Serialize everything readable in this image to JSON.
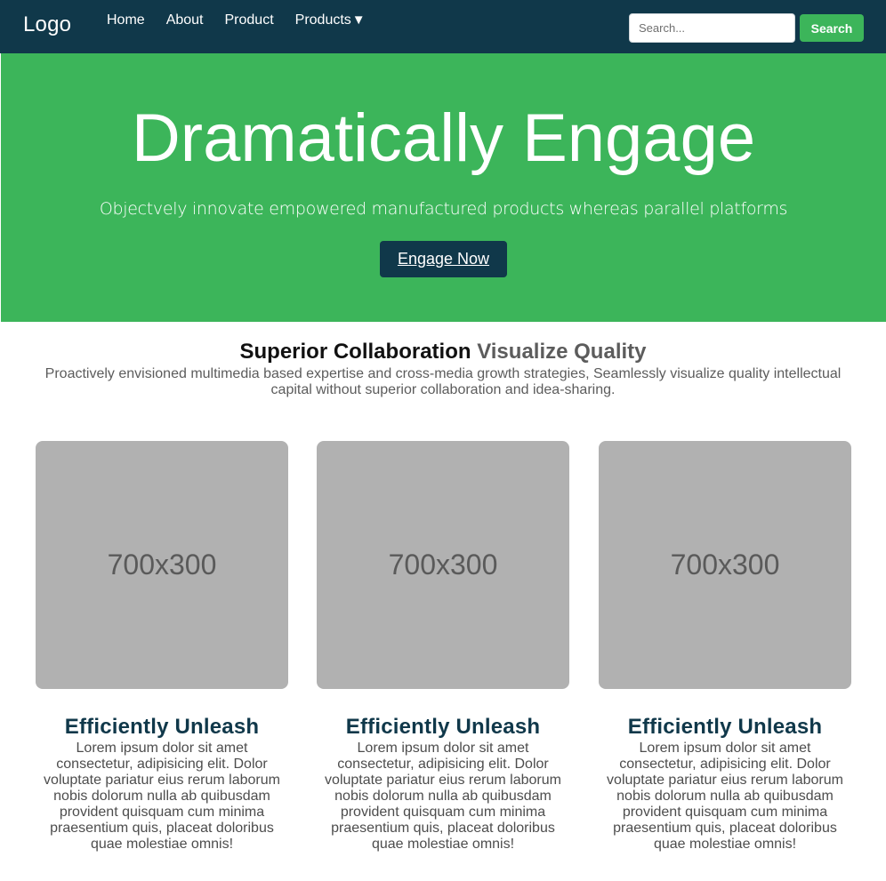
{
  "nav": {
    "logo": "Logo",
    "links": [
      {
        "label": "Home"
      },
      {
        "label": "About"
      },
      {
        "label": "Product"
      },
      {
        "label": "Products",
        "caret": "▼"
      }
    ],
    "search": {
      "placeholder": "Search...",
      "button_label": "Search"
    }
  },
  "hero": {
    "title": "Dramatically Engage",
    "subtitle": "Objectvely innovate empowered manufactured products whereas parallel platforms",
    "cta_label": "Engage Now"
  },
  "section": {
    "title_part1": "Superior Collaboration",
    "title_part2": "Visualize Quality",
    "description": "Proactively envisioned multimedia based expertise and cross-media growth strategies, Seamlessly visualize quality intellectual capital without superior collaboration and idea-sharing."
  },
  "cards": [
    {
      "image_label": "700x300",
      "title": "Efficiently Unleash",
      "text": "Lorem ipsum dolor sit amet consectetur, adipisicing elit. Dolor voluptate pariatur eius rerum laborum nobis dolorum nulla ab quibusdam provident quisquam cum minima praesentium quis, placeat doloribus quae molestiae omnis!"
    },
    {
      "image_label": "700x300",
      "title": "Efficiently Unleash",
      "text": "Lorem ipsum dolor sit amet consectetur, adipisicing elit. Dolor voluptate pariatur eius rerum laborum nobis dolorum nulla ab quibusdam provident quisquam cum minima praesentium quis, placeat doloribus quae molestiae omnis!"
    },
    {
      "image_label": "700x300",
      "title": "Efficiently Unleash",
      "text": "Lorem ipsum dolor sit amet consectetur, adipisicing elit. Dolor voluptate pariatur eius rerum laborum nobis dolorum nulla ab quibusdam provident quisquam cum minima praesentium quis, placeat doloribus quae molestiae omnis!"
    }
  ],
  "colors": {
    "navbar": "#10384a",
    "hero": "#3cb55a",
    "accent": "#3cb55a",
    "card_image": "#b1b1b1"
  }
}
